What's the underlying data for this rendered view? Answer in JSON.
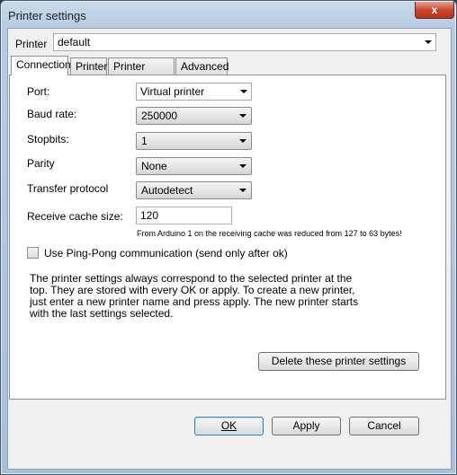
{
  "window": {
    "title": "Printer settings",
    "close_glyph": "x"
  },
  "printer": {
    "label": "Printer",
    "value": "default"
  },
  "tabs": [
    {
      "label": "Connection",
      "active": true
    },
    {
      "label": "Printer",
      "active": false
    },
    {
      "label": "Printer shape",
      "active": false
    },
    {
      "label": "Advanced",
      "active": false
    }
  ],
  "connection": {
    "port": {
      "label": "Port:",
      "value": "Virtual printer"
    },
    "baud": {
      "label": "Baud rate:",
      "value": "250000"
    },
    "stopbits": {
      "label": "Stopbits:",
      "value": "1"
    },
    "parity": {
      "label": "Parity",
      "value": "None"
    },
    "protocol": {
      "label": "Transfer protocol",
      "value": "Autodetect"
    },
    "cache": {
      "label": "Receive cache size:",
      "value": "120"
    },
    "note": "From Arduino 1 on the receiving cache was reduced from 127 to 63 bytes!",
    "pingpong": {
      "label": "Use Ping-Pong communication (send only after ok)",
      "checked": false
    },
    "description": "The printer settings always correspond to the selected printer at the top. They are stored with every OK or apply. To create a new printer, just enter a new printer name and press apply. The new printer starts with the last settings selected.",
    "delete_label": "Delete these printer settings"
  },
  "buttons": {
    "ok": "OK",
    "apply": "Apply",
    "cancel": "Cancel"
  }
}
